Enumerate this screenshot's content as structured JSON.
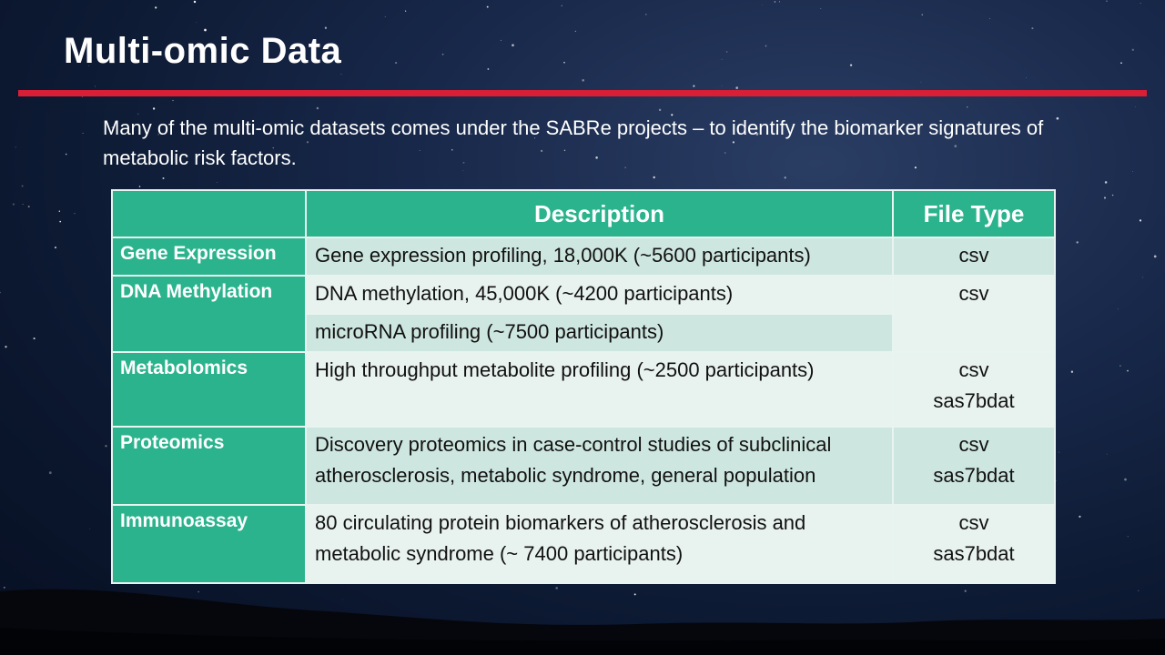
{
  "slide": {
    "title": "Multi-omic Data",
    "intro": "Many of the multi-omic datasets comes under the SABRe projects – to identify the biomarker signatures of metabolic risk factors."
  },
  "table": {
    "headers": [
      "",
      "Description",
      "File Type"
    ],
    "rows": [
      {
        "category": "Gene Expression",
        "description": [
          "Gene expression profiling, 18,000K (~5600 participants)"
        ],
        "file_types": [
          "csv"
        ]
      },
      {
        "category": "DNA Methylation",
        "description": [
          "DNA methylation, 45,000K (~4200 participants)",
          "microRNA profiling (~7500 participants)"
        ],
        "file_types": [
          "csv"
        ]
      },
      {
        "category": "Metabolomics",
        "description": [
          "High throughput metabolite profiling (~2500 participants)"
        ],
        "file_types": [
          "csv",
          "sas7bdat"
        ]
      },
      {
        "category": "Proteomics",
        "description": [
          "Discovery proteomics in case-control studies of subclinical atherosclerosis, metabolic syndrome, general population"
        ],
        "file_types": [
          "csv",
          "sas7bdat"
        ]
      },
      {
        "category": "Immunoassay",
        "description": [
          "80 circulating protein biomarkers of atherosclerosis and metabolic syndrome (~ 7400 participants)"
        ],
        "file_types": [
          "csv",
          "sas7bdat"
        ]
      }
    ]
  },
  "colors": {
    "accent_rule": "#d81f36",
    "header_green": "#2bb38d",
    "row_alt": "#cde6df",
    "row_light": "#e8f2ef"
  }
}
